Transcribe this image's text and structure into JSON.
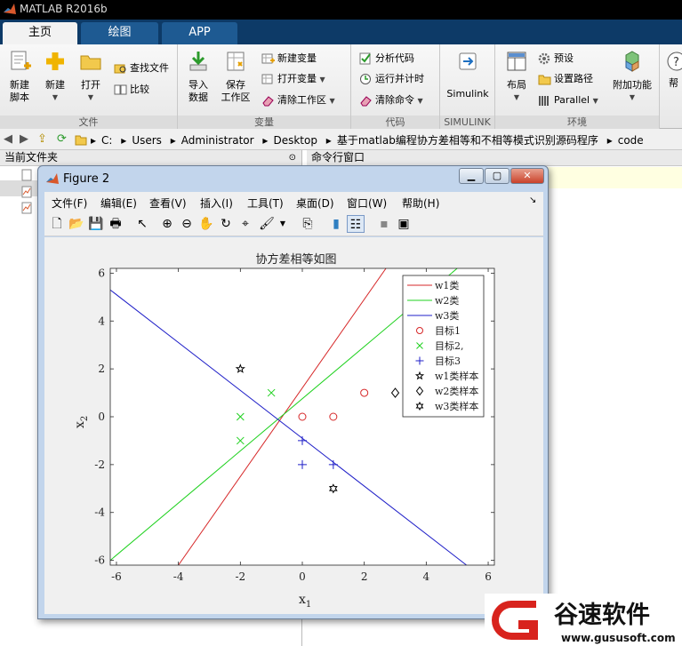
{
  "app": {
    "title": "MATLAB R2016b"
  },
  "tabs": [
    {
      "label": "主页"
    },
    {
      "label": "绘图"
    },
    {
      "label": "APP"
    }
  ],
  "ribbon": {
    "file_group": {
      "title": "文件",
      "new_script": "新建\n脚本",
      "new": "新建",
      "open": "打开",
      "find_files": "查找文件",
      "compare": "比较"
    },
    "variable_group": {
      "title": "变量",
      "import": "导入\n数据",
      "save_workspace": "保存\n工作区",
      "new_variable": "新建变量",
      "open_variable": "打开变量",
      "clear_workspace": "清除工作区"
    },
    "code_group": {
      "title": "代码",
      "analyze": "分析代码",
      "run_time": "运行并计时",
      "clear_commands": "清除命令"
    },
    "simulink_group": {
      "title": "SIMULINK",
      "simulink": "Simulink"
    },
    "env_group": {
      "title": "环境",
      "layout": "布局",
      "preferences": "预设",
      "set_path": "设置路径",
      "parallel": "Parallel",
      "addons": "附加功能"
    },
    "help": "帮"
  },
  "address": {
    "path": [
      "C:",
      "Users",
      "Administrator",
      "Desktop",
      "基于matlab编程协方差相等和不相等模式识别源码程序",
      "code"
    ]
  },
  "panels": {
    "current_folder": "当前文件夹",
    "command_window": "命令行窗口"
  },
  "figure": {
    "title": "Figure 2",
    "menu": [
      "文件(F)",
      "编辑(E)",
      "查看(V)",
      "插入(I)",
      "工具(T)",
      "桌面(D)",
      "窗口(W)",
      "帮助(H)"
    ]
  },
  "colors": {
    "w1": "#d62728",
    "w2": "#1fd11f",
    "w3": "#1f1fc8",
    "ribbon_tab": "#0d3a67"
  },
  "chart_data": {
    "type": "line",
    "title": "协方差相等如图",
    "xlabel": "x1",
    "ylabel": "x2",
    "xlim": [
      -6.2,
      6.2
    ],
    "ylim": [
      -6.2,
      6.2
    ],
    "xticks": [
      -6,
      -4,
      -2,
      0,
      2,
      4,
      6
    ],
    "yticks": [
      -6,
      -4,
      -2,
      0,
      2,
      4,
      6
    ],
    "legend_position": "top-right",
    "series": [
      {
        "name": "w1类",
        "kind": "line",
        "color": "#d62728",
        "points": [
          [
            -4,
            -6.2
          ],
          [
            2.7,
            6.2
          ]
        ]
      },
      {
        "name": "w2类",
        "kind": "line",
        "color": "#1fd11f",
        "points": [
          [
            -6.2,
            -6
          ],
          [
            5,
            6.2
          ]
        ]
      },
      {
        "name": "w3类",
        "kind": "line",
        "color": "#1f1fc8",
        "points": [
          [
            -6.2,
            5.3
          ],
          [
            5.3,
            -6.2
          ]
        ]
      },
      {
        "name": "目标1",
        "kind": "marker",
        "marker": "o",
        "color": "#d62728",
        "points": [
          [
            0,
            0
          ],
          [
            1,
            0
          ],
          [
            2,
            1
          ]
        ]
      },
      {
        "name": "目标2,",
        "kind": "marker",
        "marker": "x",
        "color": "#1fd11f",
        "points": [
          [
            -2,
            0
          ],
          [
            -2,
            -1
          ],
          [
            -1,
            1
          ]
        ]
      },
      {
        "name": "目标3",
        "kind": "marker",
        "marker": "+",
        "color": "#1f1fc8",
        "points": [
          [
            0,
            -1
          ],
          [
            0,
            -2
          ],
          [
            1,
            -2
          ]
        ]
      },
      {
        "name": "w1类样本",
        "kind": "marker",
        "marker": "star",
        "color": "#000000",
        "points": [
          [
            -2,
            2
          ]
        ]
      },
      {
        "name": "w2类样本",
        "kind": "marker",
        "marker": "diamond",
        "color": "#000000",
        "points": [
          [
            3,
            1
          ]
        ]
      },
      {
        "name": "w3类样本",
        "kind": "marker",
        "marker": "hexagram",
        "color": "#000000",
        "points": [
          [
            1,
            -3
          ]
        ]
      }
    ]
  }
}
